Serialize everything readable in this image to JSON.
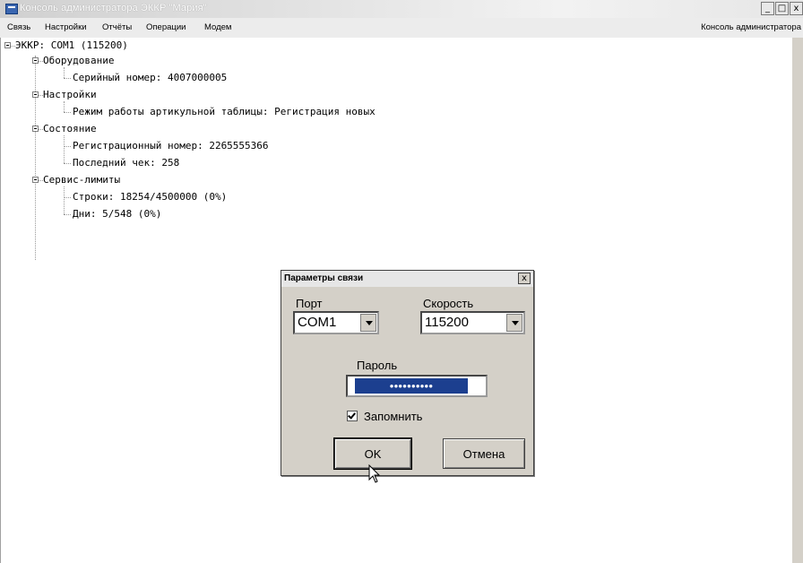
{
  "window": {
    "title": "Консоль администратора ЭККР \"Мария\"",
    "buttons": {
      "minimize": "_",
      "maximize": "□",
      "close": "x"
    }
  },
  "menu": {
    "items": [
      "Связь",
      "Настройки",
      "Отчёты",
      "Операции",
      "Модем"
    ],
    "right_label": "Консоль администратора"
  },
  "tree": {
    "root": "ЭККР: COM1 (115200)",
    "groups": [
      {
        "label": "Оборудование",
        "children": [
          "Серийный номер: 4007000005"
        ]
      },
      {
        "label": "Настройки",
        "children": [
          "Режим работы артикульной таблицы: Регистрация новых"
        ]
      },
      {
        "label": "Состояние",
        "children": [
          "Регистрационный номер: 2265555366",
          "Последний чек: 258"
        ]
      },
      {
        "label": "Сервис-лимиты",
        "children": [
          "Строки: 18254/4500000 (0%)",
          "Дни: 5/548 (0%)"
        ]
      }
    ]
  },
  "dialog": {
    "title": "Параметры связи",
    "close": "x",
    "port_label": "Порт",
    "port_value": "COM1",
    "speed_label": "Скорость",
    "speed_value": "115200",
    "password_label": "Пароль",
    "password_value": "••••••••••",
    "remember_label": "Запомнить",
    "remember_checked": true,
    "ok_label": "OK",
    "cancel_label": "Отмена"
  },
  "icons": {
    "app": "app-icon",
    "expand": "collapse-minus-icon",
    "checkbox": "check-icon",
    "pointer": "mouse-pointer-icon"
  }
}
